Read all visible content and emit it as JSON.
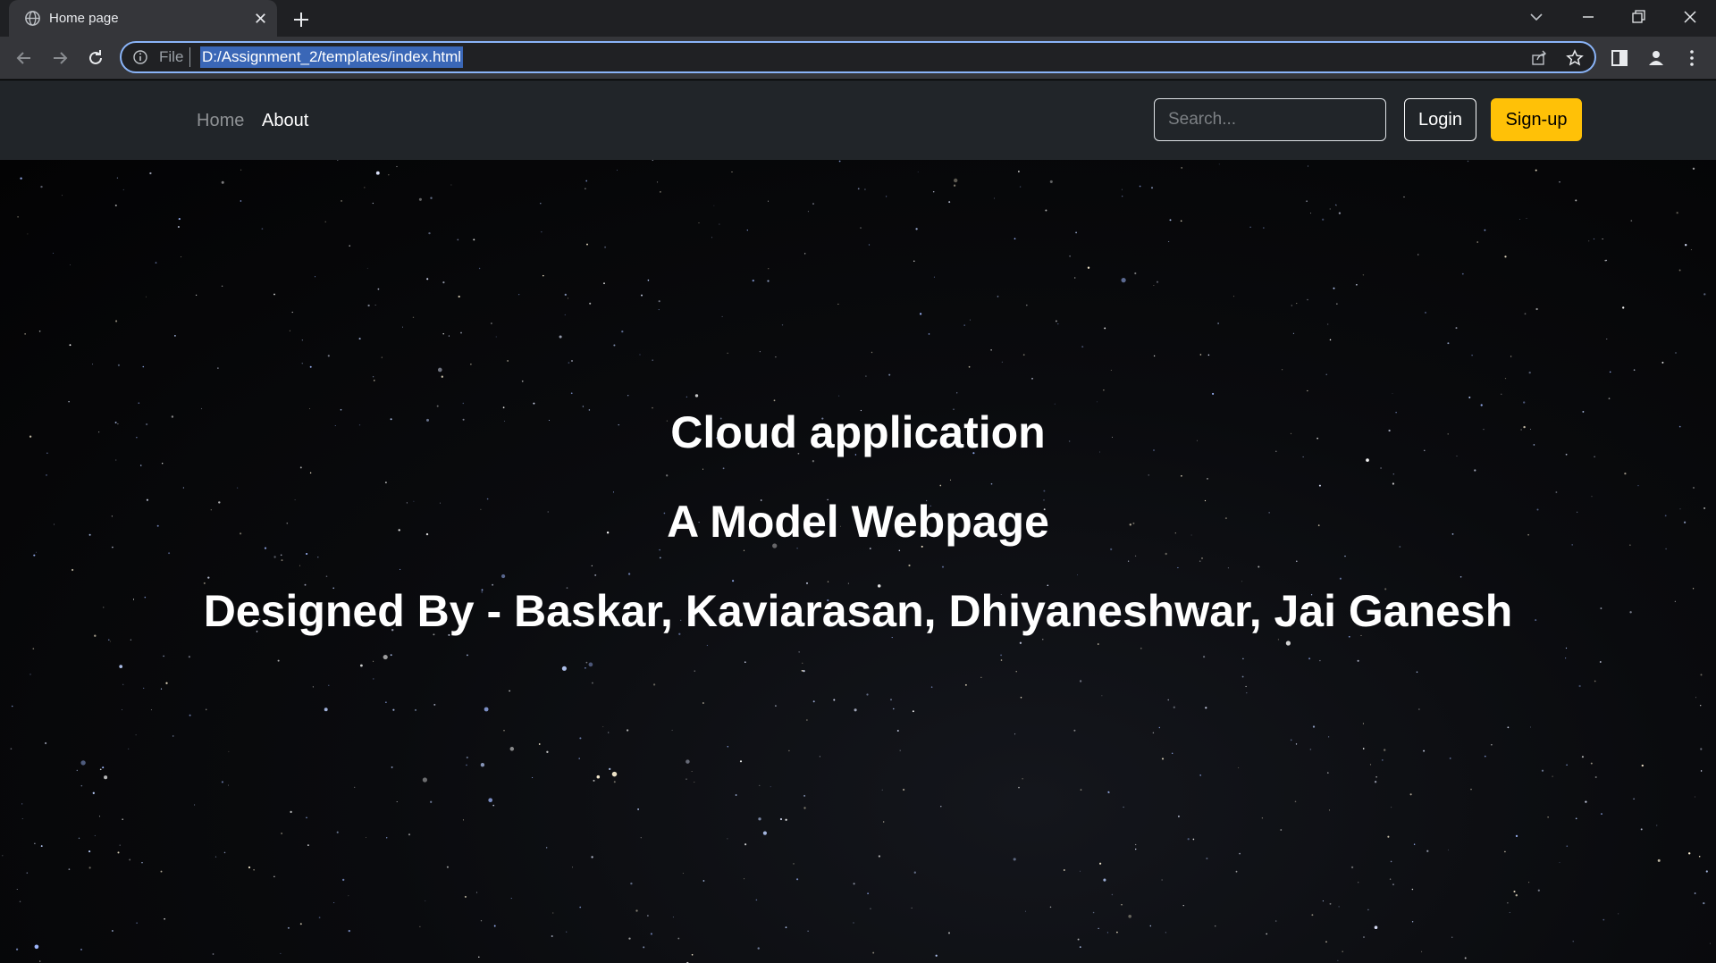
{
  "browser": {
    "tab": {
      "title": "Home page",
      "favicon": "globe-icon"
    },
    "address_bar": {
      "scheme_label": "File",
      "url": "D:/Assignment_2/templates/index.html"
    },
    "accent_color": "#8ab4f8"
  },
  "navbar": {
    "links": {
      "home": "Home",
      "about": "About"
    },
    "search": {
      "placeholder": "Search..."
    },
    "login_label": "Login",
    "signup_label": "Sign-up",
    "signup_color": "#ffc107"
  },
  "hero": {
    "title": "Cloud application",
    "subtitle": "A Model Webpage",
    "credits": "Designed By - Baskar, Kaviarasan, Dhiyaneshwar, Jai Ganesh",
    "background": "starry night sky"
  }
}
